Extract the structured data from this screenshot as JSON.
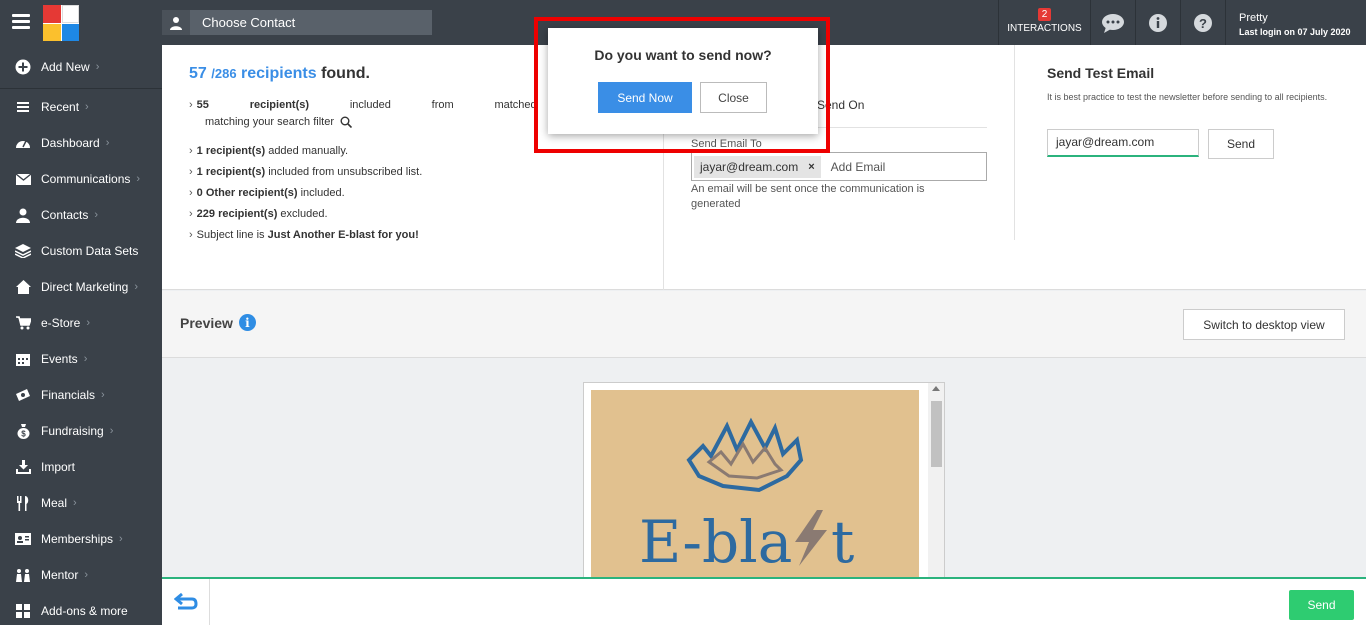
{
  "header": {
    "contact_chooser_label": "Choose Contact",
    "interactions_count": "2",
    "interactions_label": "INTERACTIONS",
    "user_name": "Pretty",
    "last_login": "Last login on 07 July 2020"
  },
  "sidebar": {
    "items": [
      {
        "label": "Add New",
        "icon": "plus-circle-icon"
      },
      {
        "label": "Recent",
        "icon": "recent-icon"
      },
      {
        "label": "Dashboard",
        "icon": "dashboard-icon"
      },
      {
        "label": "Communications",
        "icon": "envelope-icon"
      },
      {
        "label": "Contacts",
        "icon": "user-icon"
      },
      {
        "label": "Custom Data Sets",
        "icon": "layers-icon"
      },
      {
        "label": "Direct Marketing",
        "icon": "home-icon"
      },
      {
        "label": "e-Store",
        "icon": "cart-icon"
      },
      {
        "label": "Events",
        "icon": "calendar-icon"
      },
      {
        "label": "Financials",
        "icon": "money-icon"
      },
      {
        "label": "Fundraising",
        "icon": "money-bag-icon"
      },
      {
        "label": "Import",
        "icon": "import-icon"
      },
      {
        "label": "Meal",
        "icon": "meal-icon"
      },
      {
        "label": "Memberships",
        "icon": "id-card-icon"
      },
      {
        "label": "Mentor",
        "icon": "mentor-icon"
      },
      {
        "label": "Add-ons & more",
        "icon": "grid-icon"
      }
    ]
  },
  "recipients": {
    "found_count": "57",
    "total": "/286",
    "recipients_word": "recipients",
    "found_word": "found.",
    "line1_count": "55",
    "line1_word2": "recipient(s)",
    "line1_word3": "included",
    "line1_word4": "from",
    "line1_word5": "matched",
    "line1_cont": "matching your search filter",
    "line2_bold": "1 recipient(s)",
    "line2_rest": " added manually.",
    "line3_bold": "1 recipient(s)",
    "line3_rest": " included from unsubscribed list.",
    "line4_bold": "0 Other recipient(s)",
    "line4_rest": " included.",
    "line5_bold": "229 recipient(s)",
    "line5_rest": " excluded.",
    "line6_pre": "Subject line is ",
    "line6_bold": "Just Another E-blast for you!"
  },
  "send_section": {
    "send_on_label": "Send On",
    "send_email_to_label": "Send Email To",
    "email_chip": "jayar@dream.com",
    "chip_remove": "×",
    "add_email_placeholder": "Add Email",
    "note": "An email will be sent once the communication is generated"
  },
  "test_email": {
    "title": "Send Test Email",
    "description": "It is best practice to test the newsletter before sending to all recipients.",
    "input_value": "jayar@dream.com",
    "send_label": "Send"
  },
  "preview": {
    "title": "Preview",
    "switch_label": "Switch to desktop view"
  },
  "bottom": {
    "send_label": "Send"
  },
  "modal": {
    "question": "Do you want to send now?",
    "send_now_label": "Send Now",
    "close_label": "Close"
  },
  "newsletter": {
    "banner_text": "E-bla",
    "banner_text_end": "t"
  },
  "colors": {
    "sidebar_bg": "#3a4149",
    "accent_blue": "#3a8ee6",
    "accent_green": "#2ecc71",
    "modal_highlight": "#ee0000",
    "banner_bg": "#e1c18f"
  }
}
